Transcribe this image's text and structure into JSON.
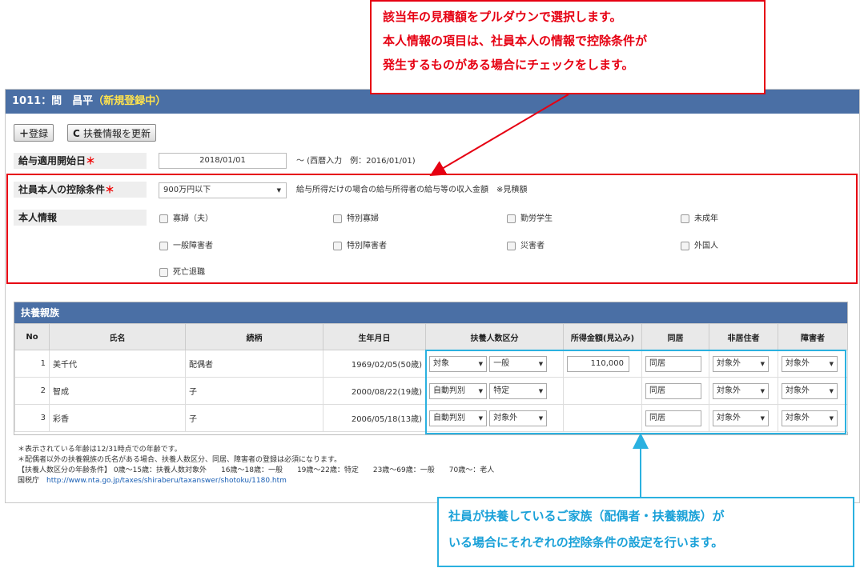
{
  "callout_top": {
    "line1": "該当年の見積額をプルダウンで選択します。",
    "line2": "本人情報の項目は、社員本人の情報で控除条件が",
    "line3": "発生するものがある場合にチェックをします。"
  },
  "callout_bottom": {
    "line1": "社員が扶養しているご家族（配偶者・扶養親族）が",
    "line2": "いる場合にそれぞれの控除条件の設定を行います。"
  },
  "title": {
    "text": "1011：間　昌平",
    "status": "（新規登録中）"
  },
  "toolbar": {
    "register": "登録",
    "update": "扶養情報を更新"
  },
  "start_date": {
    "label": "給与適用開始日",
    "required": "＊",
    "value": "2018/01/01",
    "hint": "～ (西暦入力　例：2016/01/01)"
  },
  "deduction": {
    "label": "社員本人の控除条件",
    "required": "＊",
    "selected": "900万円以下",
    "note": "給与所得だけの場合の給与所得者の給与等の収入金額　※見積額"
  },
  "personal": {
    "label": "本人情報",
    "options": [
      "寡婦（夫）",
      "特別寡婦",
      "勤労学生",
      "未成年",
      "一般障害者",
      "特別障害者",
      "災害者",
      "外国人",
      "死亡退職"
    ]
  },
  "dependents": {
    "title": "扶養親族",
    "headers": [
      "No",
      "氏名",
      "続柄",
      "生年月日",
      "扶養人数区分",
      "所得金額(見込み)",
      "同居",
      "非居住者",
      "障害者"
    ],
    "rows": [
      {
        "no": "1",
        "name": "美千代",
        "rel": "配偶者",
        "birth": "1969/02/05(50歳)",
        "kubun1": "対象",
        "kubun2": "一般",
        "income": "110,000",
        "doukyo": "同居",
        "hikyo": "対象外",
        "shogai": "対象外"
      },
      {
        "no": "2",
        "name": "智成",
        "rel": "子",
        "birth": "2000/08/22(19歳)",
        "kubun1": "自動判別",
        "kubun2": "特定",
        "income": "",
        "doukyo": "同居",
        "hikyo": "対象外",
        "shogai": "対象外"
      },
      {
        "no": "3",
        "name": "彩香",
        "rel": "子",
        "birth": "2006/05/18(13歳)",
        "kubun1": "自動判別",
        "kubun2": "対象外",
        "income": "",
        "doukyo": "同居",
        "hikyo": "対象外",
        "shogai": "対象外"
      }
    ]
  },
  "footer": {
    "line1": "＊表示されている年齢は12/31時点での年齢です。",
    "line2": "＊配偶者以外の扶養親族の氏名がある場合、扶養人数区分、同居、障害者の登録は必須になります。",
    "line3": "【扶養人数区分の年齢条件】 0歳～15歳：扶養人数対象外　　16歳～18歳：一般　　19歳～22歳：特定　　23歳～69歳：一般　　70歳～：老人",
    "tax_label": "国税庁",
    "tax_url": "http://www.nta.go.jp/taxes/shiraberu/taxanswer/shotoku/1180.htm"
  },
  "colors": {
    "header_blue": "#4a6fa5",
    "red": "#e60012",
    "cyan": "#2bb1e0",
    "status_yellow": "#ffe34d"
  }
}
